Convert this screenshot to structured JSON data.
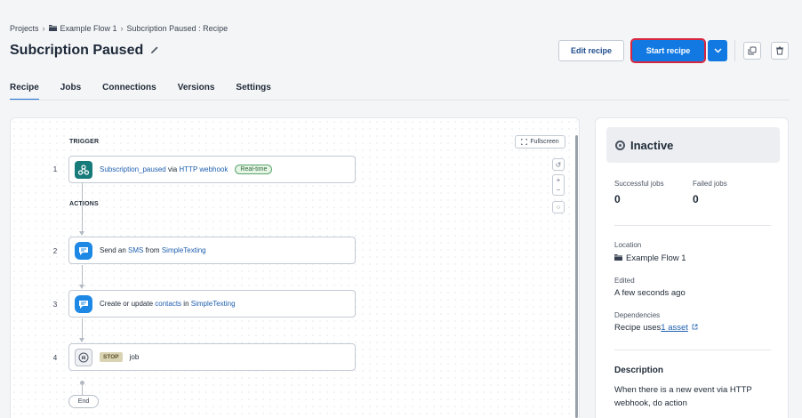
{
  "breadcrumb": {
    "projects": "Projects",
    "flow": "Example Flow 1",
    "current": "Subcription Paused : Recipe",
    "separator": "›"
  },
  "page": {
    "title": "Subcription Paused"
  },
  "toolbar": {
    "edit_label": "Edit recipe",
    "start_label": "Start recipe"
  },
  "tabs": [
    {
      "label": "Recipe",
      "active": true
    },
    {
      "label": "Jobs"
    },
    {
      "label": "Connections"
    },
    {
      "label": "Versions"
    },
    {
      "label": "Settings"
    }
  ],
  "canvas": {
    "trigger_label": "TRIGGER",
    "actions_label": "ACTIONS",
    "fullscreen_label": "Fullscreen",
    "end_label": "End",
    "steps": [
      {
        "num": "1",
        "icon": "webhook-icon",
        "parts": [
          "Subscription_paused",
          " via ",
          "HTTP webhook"
        ],
        "badge": "Real-time"
      },
      {
        "num": "2",
        "icon": "chat-bubble-icon",
        "parts": [
          "Send an ",
          "SMS",
          " from ",
          "SimpleTexting"
        ]
      },
      {
        "num": "3",
        "icon": "chat-bubble-icon",
        "parts": [
          "Create or update ",
          "contacts",
          " in ",
          "SimpleTexting"
        ]
      },
      {
        "num": "4",
        "icon": "stop-hand-icon",
        "stop_badge": "STOP",
        "text": "job"
      }
    ]
  },
  "sidebar": {
    "status": "Inactive",
    "successful_label": "Successful jobs",
    "successful_value": "0",
    "failed_label": "Failed jobs",
    "failed_value": "0",
    "location_label": "Location",
    "location_value": "Example Flow 1",
    "edited_label": "Edited",
    "edited_value": "A few seconds ago",
    "deps_label": "Dependencies",
    "deps_prefix": "Recipe uses ",
    "deps_link": "1 asset",
    "description_label": "Description",
    "description_text": "When there is a new event via HTTP webhook, do action"
  },
  "colors": {
    "primary": "#1279e3",
    "highlight_border": "#d7263d",
    "link": "#1f5fae",
    "webhook_tile": "#177b7a",
    "chat_tile": "#1e88e5"
  }
}
